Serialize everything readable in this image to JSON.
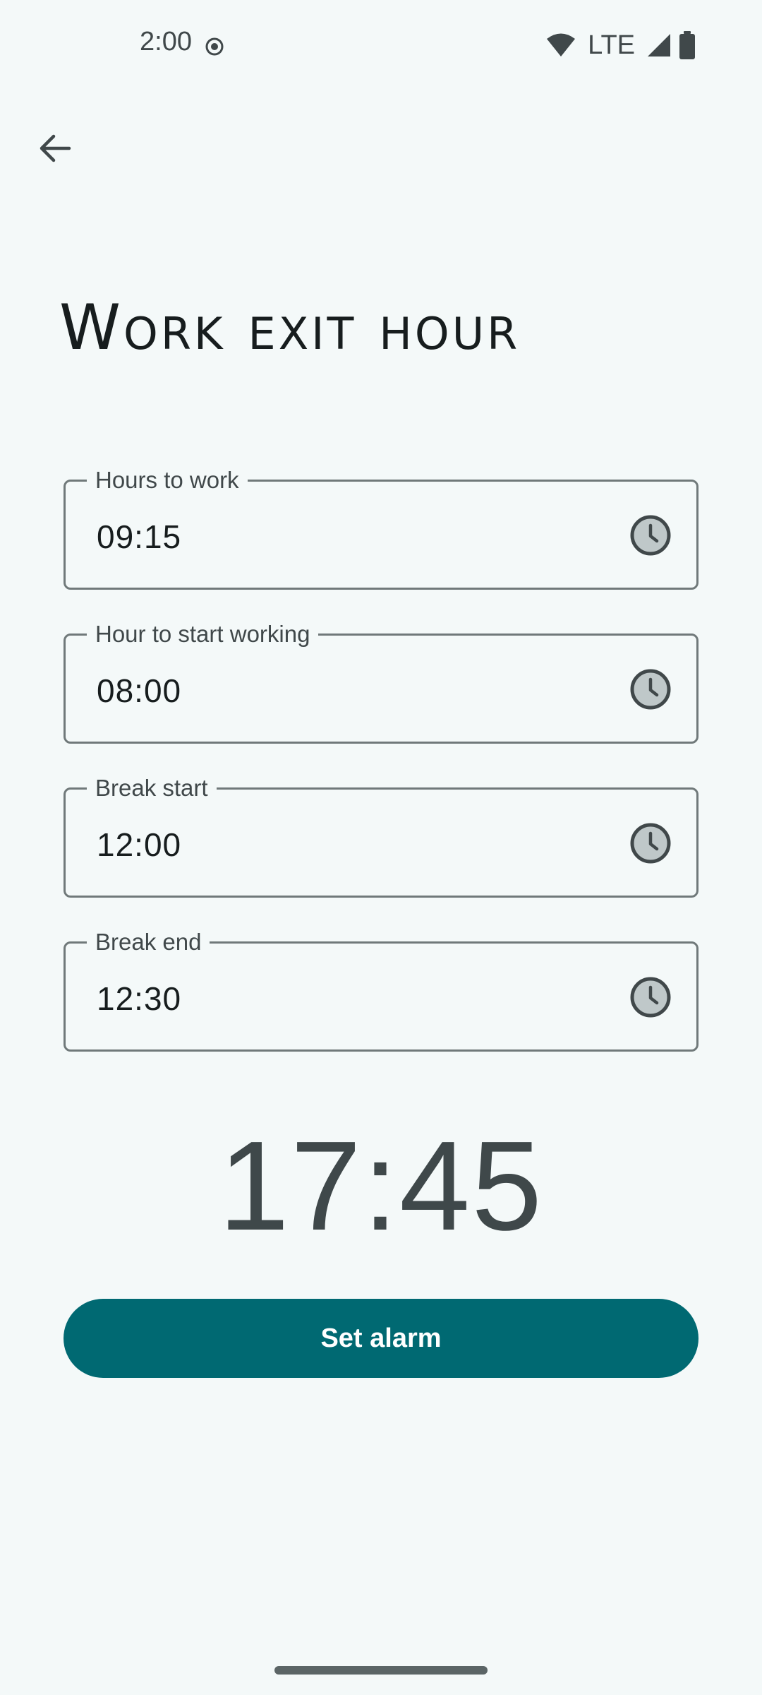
{
  "status_bar": {
    "time": "2:00",
    "network_label": "LTE",
    "icons": [
      "record-icon",
      "wifi-icon",
      "cell-signal-icon",
      "battery-icon"
    ]
  },
  "header": {
    "back_icon": "arrow-back-icon",
    "title": "Work exit hour"
  },
  "fields": [
    {
      "label": "Hours to work",
      "value": "09:15",
      "icon": "clock-icon"
    },
    {
      "label": "Hour to start working",
      "value": "08:00",
      "icon": "clock-icon"
    },
    {
      "label": "Break start",
      "value": "12:00",
      "icon": "clock-icon"
    },
    {
      "label": "Break end",
      "value": "12:30",
      "icon": "clock-icon"
    }
  ],
  "result": {
    "exit_time": "17:45"
  },
  "actions": {
    "set_alarm_label": "Set alarm"
  },
  "colors": {
    "background": "#f4f9f9",
    "primary": "#006972",
    "outline": "#70797a",
    "on_surface": "#171d1e",
    "on_surface_variant": "#40484a"
  }
}
